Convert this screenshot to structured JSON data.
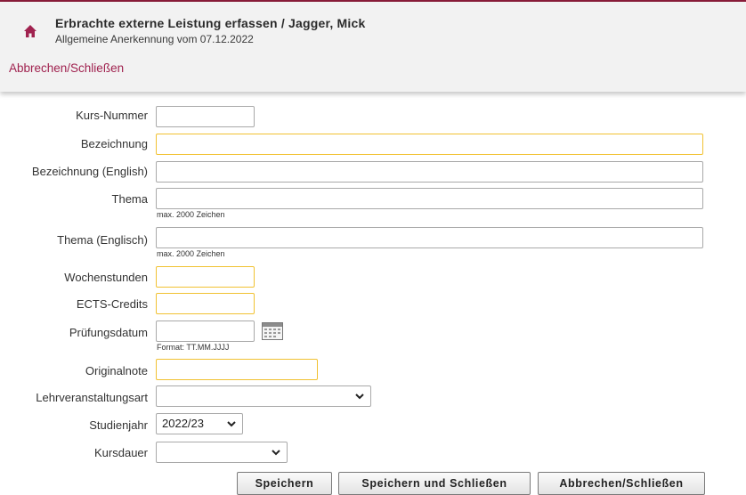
{
  "header": {
    "title": "Erbrachte externe Leistung erfassen  / Jagger, Mick",
    "subtitle": "Allgemeine Anerkennung vom 07.12.2022",
    "cancel_link": "Abbrechen/Schließen"
  },
  "form": {
    "kurs_nummer": {
      "label": "Kurs-Nummer",
      "value": ""
    },
    "bezeichnung": {
      "label": "Bezeichnung",
      "value": ""
    },
    "bezeichnung_en": {
      "label": "Bezeichnung (English)",
      "value": ""
    },
    "thema": {
      "label": "Thema",
      "value": "",
      "hint": "max. 2000 Zeichen"
    },
    "thema_en": {
      "label": "Thema (Englisch)",
      "value": "",
      "hint": "max. 2000 Zeichen"
    },
    "wochenstunden": {
      "label": "Wochenstunden",
      "value": ""
    },
    "ects": {
      "label": "ECTS-Credits",
      "value": ""
    },
    "pruefungsdatum": {
      "label": "Prüfungsdatum",
      "value": "",
      "hint": "Format: TT.MM.JJJJ"
    },
    "originalnote": {
      "label": "Originalnote",
      "value": ""
    },
    "lv_art": {
      "label": "Lehrveranstaltungsart",
      "selected": ""
    },
    "studienjahr": {
      "label": "Studienjahr",
      "selected": "2022/23"
    },
    "kursdauer": {
      "label": "Kursdauer",
      "selected": ""
    }
  },
  "buttons": {
    "save": "Speichern",
    "save_close": "Speichern und Schließen",
    "cancel_close": "Abbrechen/Schließen"
  },
  "icons": {
    "home": "home-icon",
    "calendar": "calendar-icon",
    "chevron": "chevron-down-icon"
  },
  "colors": {
    "accent": "#a0224f",
    "required_border": "#f1c232",
    "header_bg": "#f2f2f2"
  }
}
